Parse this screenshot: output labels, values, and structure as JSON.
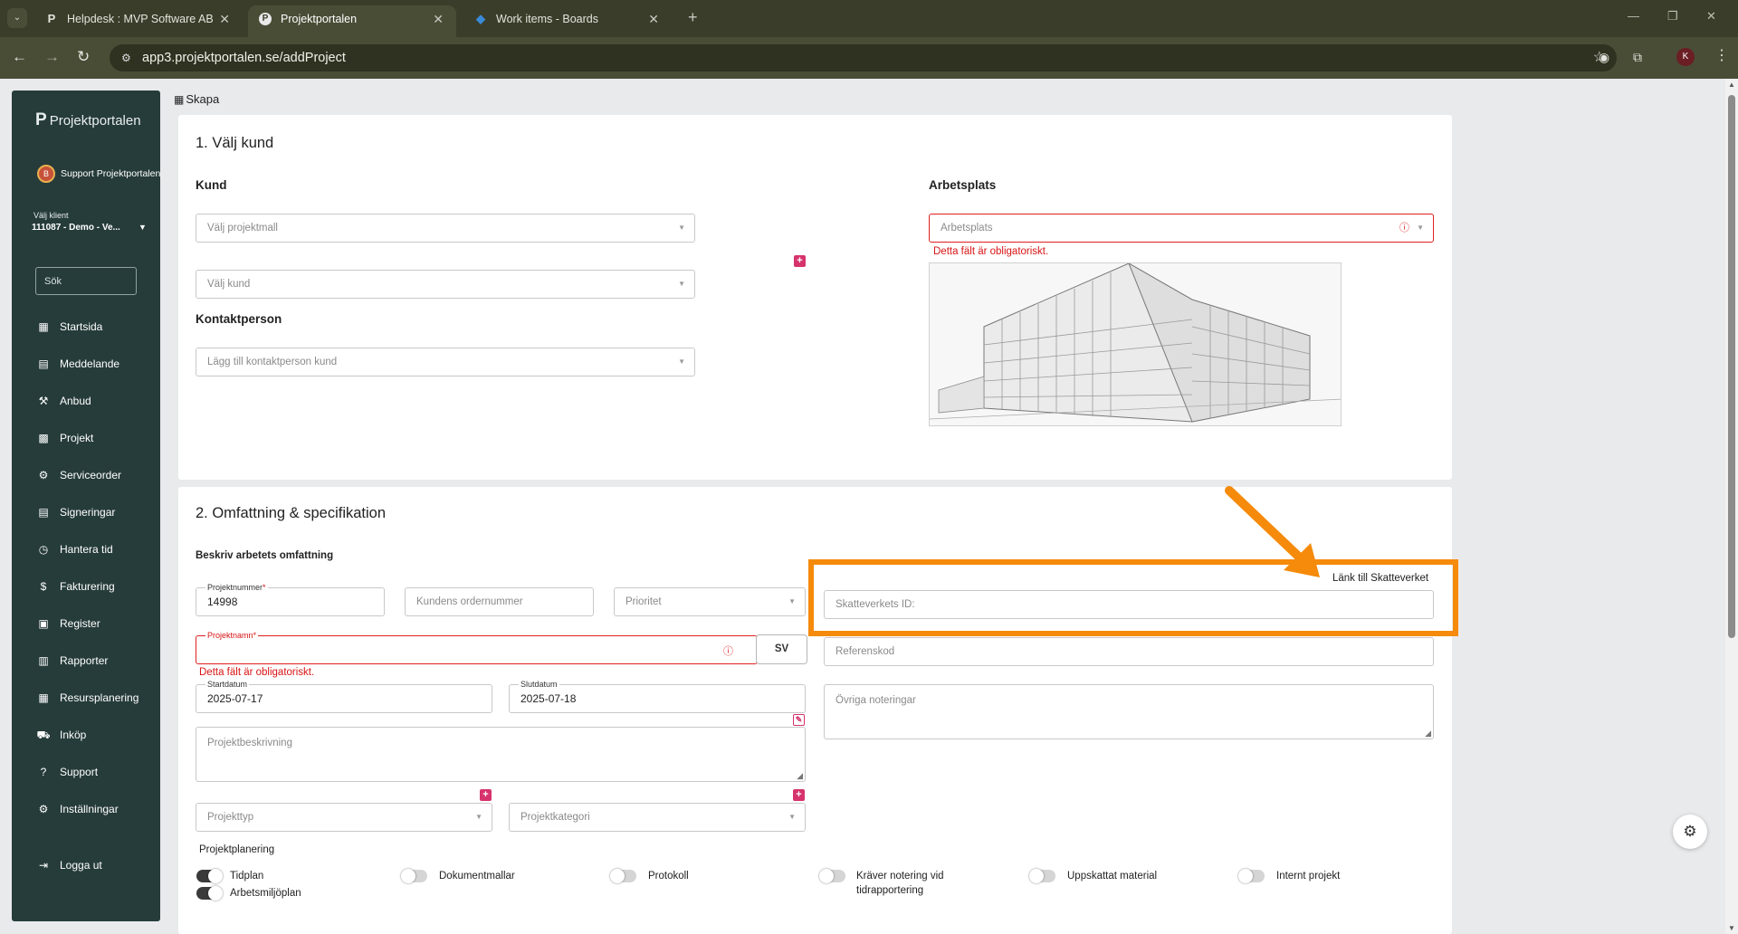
{
  "browser": {
    "tabs": [
      {
        "title": "Helpdesk : MVP Software AB",
        "icon": "projektportalen-p-icon"
      },
      {
        "title": "Projektportalen",
        "icon": "projektportalen-icon"
      },
      {
        "title": "Work items - Boards",
        "icon": "azure-boards-icon"
      }
    ],
    "url": "app3.projektportalen.se/addProject",
    "profile_initial": "K"
  },
  "sidebar": {
    "logo_text": "Projektportalen",
    "user_name": "Support Projektportalen",
    "user_avatar_initial": "B",
    "client_label": "Välj klient",
    "client_value": "111087 - Demo - Ve...",
    "search_placeholder": "Sök",
    "items": [
      {
        "label": "Startsida",
        "icon": "dashboard-icon"
      },
      {
        "label": "Meddelande",
        "icon": "message-icon"
      },
      {
        "label": "Anbud",
        "icon": "gavel-icon"
      },
      {
        "label": "Projekt",
        "icon": "grid-icon"
      },
      {
        "label": "Serviceorder",
        "icon": "wrench-icon"
      },
      {
        "label": "Signeringar",
        "icon": "signature-icon"
      },
      {
        "label": "Hantera tid",
        "icon": "clock-icon"
      },
      {
        "label": "Fakturering",
        "icon": "dollar-icon"
      },
      {
        "label": "Register",
        "icon": "register-icon"
      },
      {
        "label": "Rapporter",
        "icon": "reports-icon"
      },
      {
        "label": "Resursplanering",
        "icon": "calendar-icon"
      },
      {
        "label": "Inköp",
        "icon": "cart-icon"
      },
      {
        "label": "Support",
        "icon": "help-icon"
      },
      {
        "label": "Inställningar",
        "icon": "settings-icon"
      }
    ],
    "logout_label": "Logga ut"
  },
  "breadcrumb": "Skapa",
  "section1": {
    "title": "1. Välj kund",
    "kund_heading": "Kund",
    "projektmall_placeholder": "Välj projektmall",
    "kund_placeholder": "Välj kund",
    "kontaktperson_heading": "Kontaktperson",
    "kontaktperson_placeholder": "Lägg till kontaktperson kund",
    "arbetsplats_heading": "Arbetsplats",
    "arbetsplats_placeholder": "Arbetsplats",
    "arbetsplats_error": "Detta fält är obligatoriskt."
  },
  "section2": {
    "title": "2. Omfattning & specifikation",
    "scope_heading": "Beskriv arbetets omfattning",
    "projektnummer_label": "Projektnummer",
    "projektnummer_value": "14998",
    "ordernummer_placeholder": "Kundens ordernummer",
    "prioritet_placeholder": "Prioritet",
    "projektnamn_label": "Projektnamn",
    "projektnamn_error": "Detta fält är obligatoriskt.",
    "language_button": "SV",
    "startdatum_label": "Startdatum",
    "startdatum_value": "2025-07-17",
    "slutdatum_label": "Slutdatum",
    "slutdatum_value": "2025-07-18",
    "beskrivning_placeholder": "Projektbeskrivning",
    "projekttyp_placeholder": "Projekttyp",
    "projektkategori_placeholder": "Projektkategori",
    "skatteverket_link": "Länk till Skatteverket",
    "skatteverket_placeholder": "Skatteverkets ID:",
    "referenskod_placeholder": "Referenskod",
    "noteringar_placeholder": "Övriga noteringar",
    "planering_heading": "Projektplanering",
    "toggles": [
      {
        "label": "Tidplan",
        "on": true
      },
      {
        "label": "Arbetsmiljöplan",
        "on": true
      },
      {
        "label": "Dokumentmallar",
        "on": false
      },
      {
        "label": "Protokoll",
        "on": false
      },
      {
        "label": "Kräver notering vid tidrapportering",
        "on": false
      },
      {
        "label": "Uppskattat material",
        "on": false
      },
      {
        "label": "Internt projekt",
        "on": false
      }
    ]
  },
  "colors": {
    "sidebar_bg": "#263c3b",
    "error_red": "#e02020",
    "highlight_orange": "#f58a0b",
    "plus_pink": "#d6336c"
  }
}
